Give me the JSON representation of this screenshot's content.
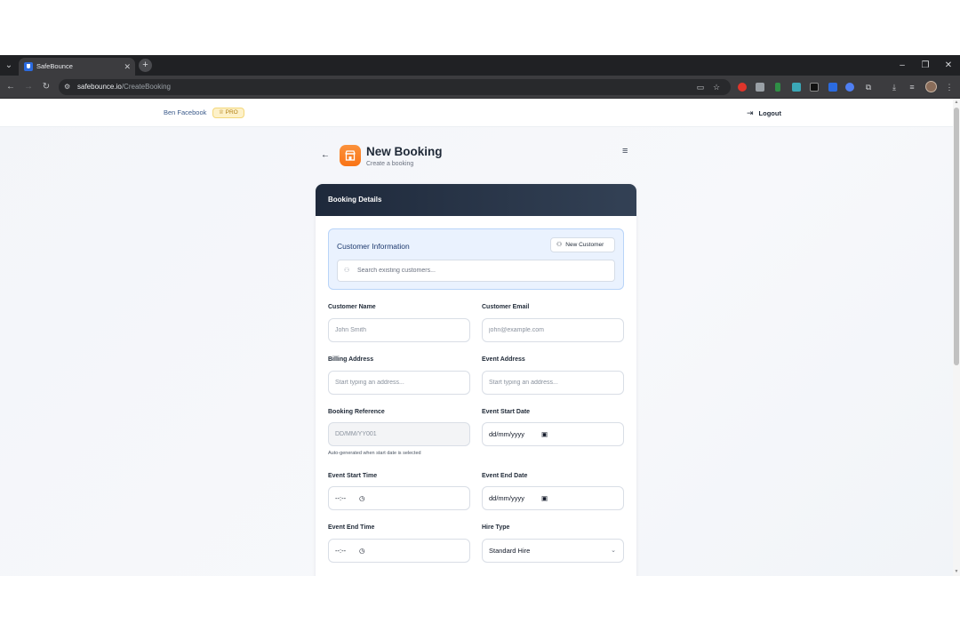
{
  "browser": {
    "tab_title": "SafeBounce",
    "url_host": "safebounce.io",
    "url_path": "/CreateBooking"
  },
  "topbar": {
    "user_name": "Ben Facebook",
    "badge": "PRO",
    "logout_label": "Logout"
  },
  "header": {
    "title": "New Booking",
    "subtitle": "Create a booking"
  },
  "card": {
    "title": "Booking Details"
  },
  "customer_info": {
    "title": "Customer Information",
    "new_customer_label": "New Customer",
    "search_placeholder": "Search existing customers..."
  },
  "fields": {
    "customer_name": {
      "label": "Customer Name",
      "placeholder": "John Smith"
    },
    "customer_email": {
      "label": "Customer Email",
      "placeholder": "john@example.com"
    },
    "billing_address": {
      "label": "Billing Address",
      "placeholder": "Start typing an address..."
    },
    "event_address": {
      "label": "Event Address",
      "placeholder": "Start typing an address..."
    },
    "booking_reference": {
      "label": "Booking Reference",
      "placeholder": "DD/MM/YY001",
      "hint": "Auto-generated when start date is selected"
    },
    "event_start_date": {
      "label": "Event Start Date",
      "value": "dd/mm/yyyy"
    },
    "event_start_time": {
      "label": "Event Start Time",
      "value": "--:--"
    },
    "event_end_date": {
      "label": "Event End Date",
      "value": "dd/mm/yyyy"
    },
    "event_end_time": {
      "label": "Event End Time",
      "value": "--:--"
    },
    "hire_type": {
      "label": "Hire Type",
      "value": "Standard Hire"
    }
  },
  "icons": {
    "back": "arrow-left-icon",
    "app": "store-icon",
    "menu": "hamburger-menu-icon",
    "calendar": "calendar-icon",
    "clock": "clock-icon",
    "chevron": "chevron-down-icon"
  },
  "colors": {
    "accent": "#f97316",
    "header_bg": "#1e293b",
    "panel_bg": "#eaf2fe",
    "panel_border": "#b9d4f8",
    "badge_bg": "#fdf1c9"
  }
}
